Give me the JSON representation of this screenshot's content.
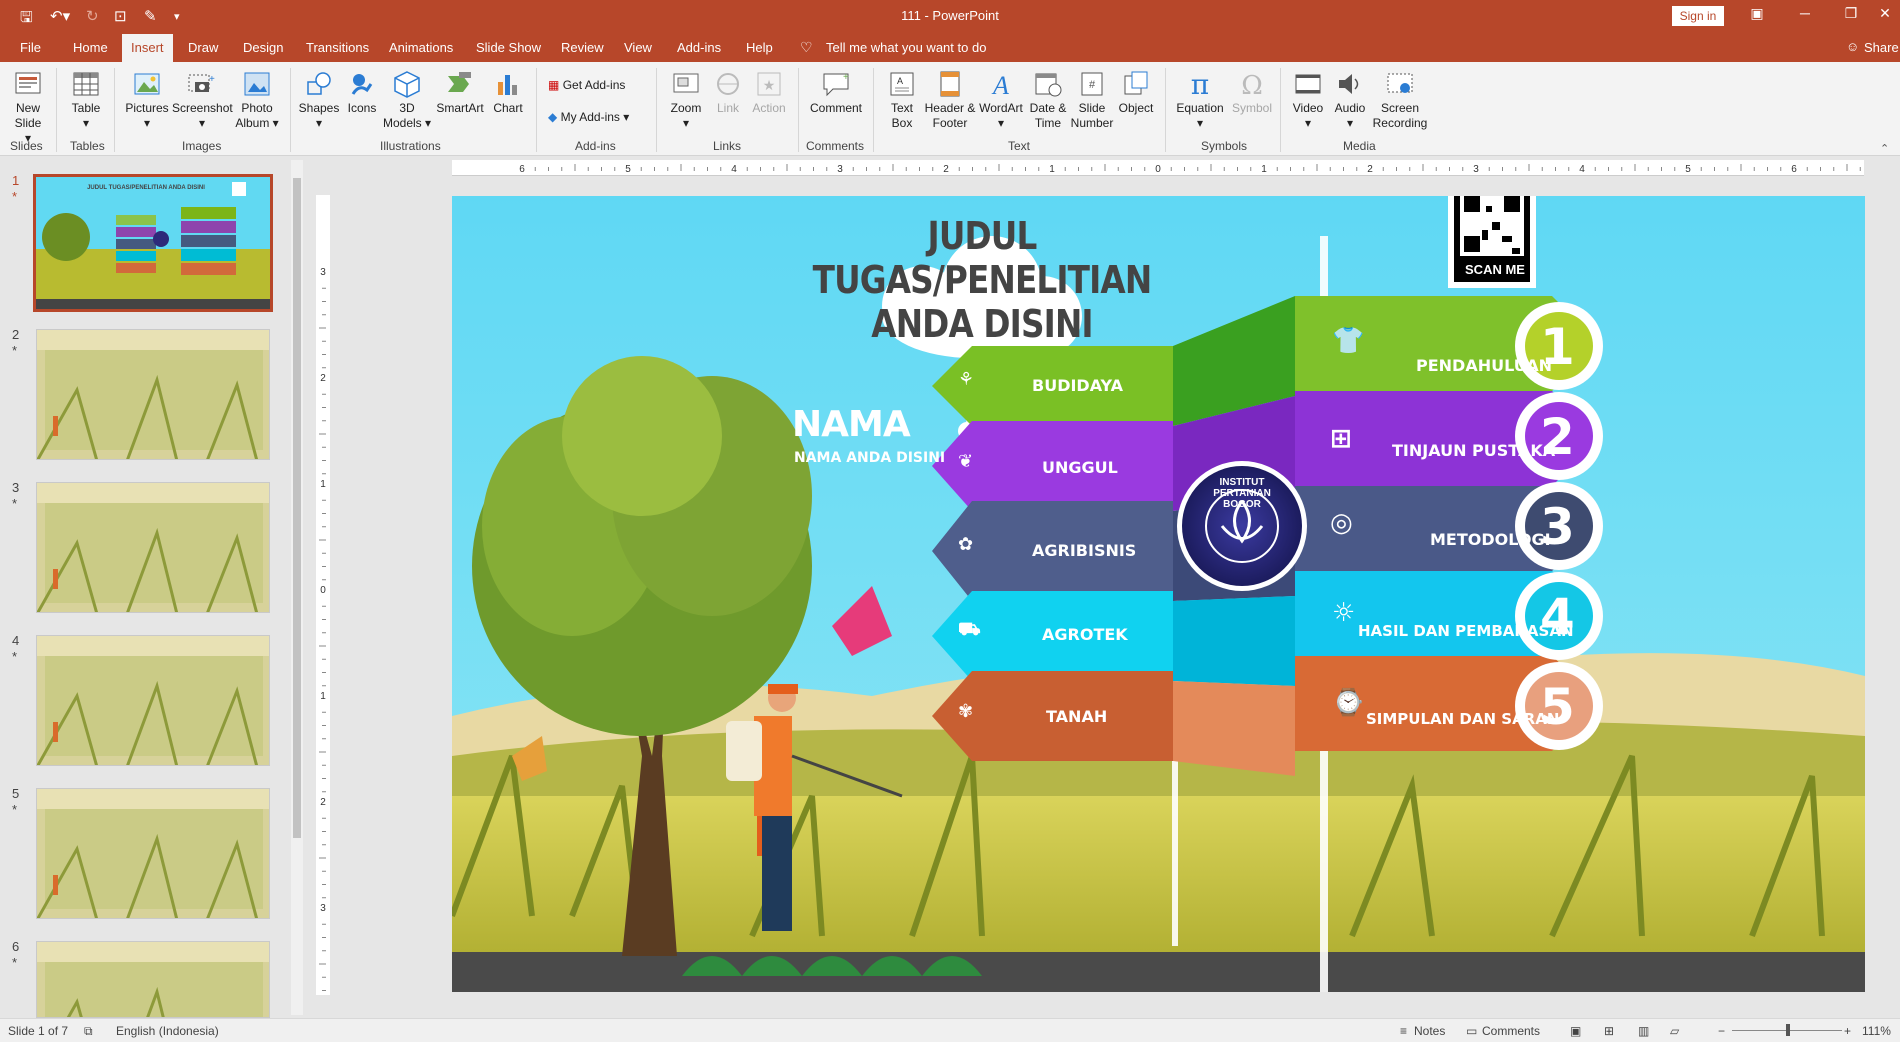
{
  "window": {
    "title": "111  -  PowerPoint",
    "sign_in": "Sign in",
    "share": "Share",
    "tell_me": "Tell me what you want to do"
  },
  "colors": {
    "accent": "#b7472a",
    "ribbon": "#f3f3f3"
  },
  "tabs": [
    "File",
    "Home",
    "Insert",
    "Draw",
    "Design",
    "Transitions",
    "Animations",
    "Slide Show",
    "Review",
    "View",
    "Add-ins",
    "Help"
  ],
  "ribbon": {
    "new_slide": "New Slide",
    "table": "Table",
    "pictures": "Pictures",
    "screenshot": "Screenshot",
    "photo_album": "Photo Album",
    "shapes": "Shapes",
    "icons": "Icons",
    "models_3d": "3D Models",
    "smartart": "SmartArt",
    "chart": "Chart",
    "get_addins": "Get Add-ins",
    "my_addins": "My Add-ins",
    "zoom": "Zoom",
    "link": "Link",
    "action": "Action",
    "comment": "Comment",
    "text_box": "Text Box",
    "header_footer": "Header & Footer",
    "wordart": "WordArt",
    "date_time": "Date & Time",
    "slide_number": "Slide Number",
    "object": "Object",
    "equation": "Equation",
    "symbol": "Symbol",
    "video": "Video",
    "audio": "Audio",
    "screen_recording": "Screen Recording",
    "groups": {
      "slides": "Slides",
      "tables": "Tables",
      "images": "Images",
      "illustrations": "Illustrations",
      "addins": "Add-ins",
      "links": "Links",
      "comments": "Comments",
      "text": "Text",
      "symbols": "Symbols",
      "media": "Media"
    }
  },
  "thumbnails": [
    {
      "num": "1",
      "star": "*"
    },
    {
      "num": "2",
      "star": "*"
    },
    {
      "num": "3",
      "star": "*"
    },
    {
      "num": "4",
      "star": "*"
    },
    {
      "num": "5",
      "star": "*"
    },
    {
      "num": "6",
      "star": "*"
    }
  ],
  "thumb1_title": "JUDUL TUGAS/PENELITIAN ANDA DISINI",
  "slide": {
    "title": "JUDUL TUGAS/PENELITIAN ANDA DISINI",
    "scan": "SCAN ME",
    "name": "NAMA",
    "name_sub": "NAMA ANDA DISINI",
    "logo_text": "INSTITUT PERTANIAN BOGOR",
    "left_items": [
      "BUDIDAYA",
      "UNGGUL",
      "AGRIBISNIS",
      "AGROTEK",
      "TANAH"
    ],
    "right_items": [
      {
        "label": "PENDAHULUAN",
        "num": "1"
      },
      {
        "label": "TINJAUN PUSTAKA",
        "num": "2"
      },
      {
        "label": "METODOLOGI",
        "num": "3"
      },
      {
        "label": "HASIL DAN PEMBAHASAN",
        "num": "4"
      },
      {
        "label": "SIMPULAN DAN SARAN",
        "num": "5"
      }
    ]
  },
  "ruler": {
    "h": [
      "6",
      "5",
      "4",
      "3",
      "2",
      "1",
      "0",
      "1",
      "2",
      "3",
      "4",
      "5",
      "6"
    ],
    "v": [
      "3",
      "2",
      "1",
      "0",
      "1",
      "2",
      "3"
    ]
  },
  "status": {
    "slide": "Slide 1 of 7",
    "language": "English (Indonesia)",
    "notes": "Notes",
    "comments": "Comments",
    "zoom": "111%"
  }
}
